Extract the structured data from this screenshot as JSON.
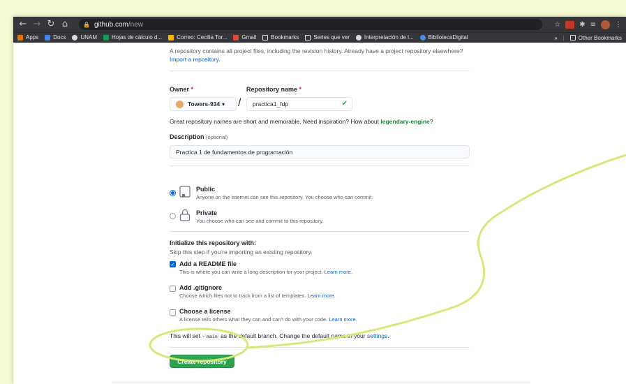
{
  "browser": {
    "url_host": "github.com",
    "url_path": "/new",
    "bookmarks": [
      {
        "label": "Apps",
        "icon": "apps-grid-icon",
        "color": "#e37400"
      },
      {
        "label": "Docs",
        "icon": "docs-icon",
        "color": "#4285f4"
      },
      {
        "label": "UNAM",
        "icon": "globe-icon",
        "color": "#dadada"
      },
      {
        "label": "Hojas de cálculo d...",
        "icon": "sheets-icon",
        "color": "#0f9d58"
      },
      {
        "label": "Correo: Cecilia Tor...",
        "icon": "outlook-icon",
        "color": "#f4b400"
      },
      {
        "label": "Gmail",
        "icon": "gmail-icon",
        "color": "#ea4335"
      },
      {
        "label": "Bookmarks",
        "icon": "star-icon",
        "color": "#e3e3e3"
      },
      {
        "label": "Series que ver",
        "icon": "folder-icon",
        "color": "#e3e3e3"
      },
      {
        "label": "Interpretación de l...",
        "icon": "globe-icon",
        "color": "#dadada"
      },
      {
        "label": "BibliotecaDigital",
        "icon": "cloud-icon",
        "color": "#4a90e2"
      }
    ],
    "more_label": "»",
    "other_bookmarks": "Other Bookmarks"
  },
  "form": {
    "intro_text": "A repository contains all project files, including the revision history. Already have a project repository elsewhere?",
    "import_link": "Import a repository.",
    "owner_label": "Owner",
    "required_mark": "*",
    "owner_value": "Towers-934",
    "owner_caret": "▾",
    "slash": "/",
    "repo_name_label": "Repository name",
    "repo_name_value": "practica1_fdp",
    "name_hint_prefix": "Great repository names are short and memorable. Need inspiration? How about",
    "suggested_name": "legendary-engine",
    "name_hint_suffix": "?",
    "description_label": "Description",
    "description_optional": "(optional)",
    "description_value": "Practica 1 de fundamentos de programación",
    "visibility": {
      "selected": "public",
      "public_title": "Public",
      "public_desc": "Anyone on the internet can see this repository. You choose who can commit.",
      "private_title": "Private",
      "private_desc": "You choose who can see and commit to this repository."
    },
    "init_title": "Initialize this repository with:",
    "init_subtitle": "Skip this step if you’re importing an existing repository.",
    "readme": {
      "title": "Add a README file",
      "desc": "This is where you can write a long description for your project.",
      "link": "Learn more.",
      "checked": true
    },
    "gitignore": {
      "title": "Add .gitignore",
      "desc": "Choose which files not to track from a list of templates.",
      "link": "Learn more.",
      "checked": false
    },
    "license": {
      "title": "Choose a license",
      "desc": "A license tells others what they can and can’t do with your code.",
      "link": "Learn more.",
      "checked": false
    },
    "branch_prefix": "This will set",
    "branch_name": "main",
    "branch_suffix": "as the default branch. Change the default name in your",
    "settings_link": "settings",
    "branch_end": ".",
    "create_button": "Create repository"
  },
  "colors": {
    "primary_green": "#2ea44f",
    "link_blue": "#0366d6",
    "annotation": "#d6e87a"
  }
}
